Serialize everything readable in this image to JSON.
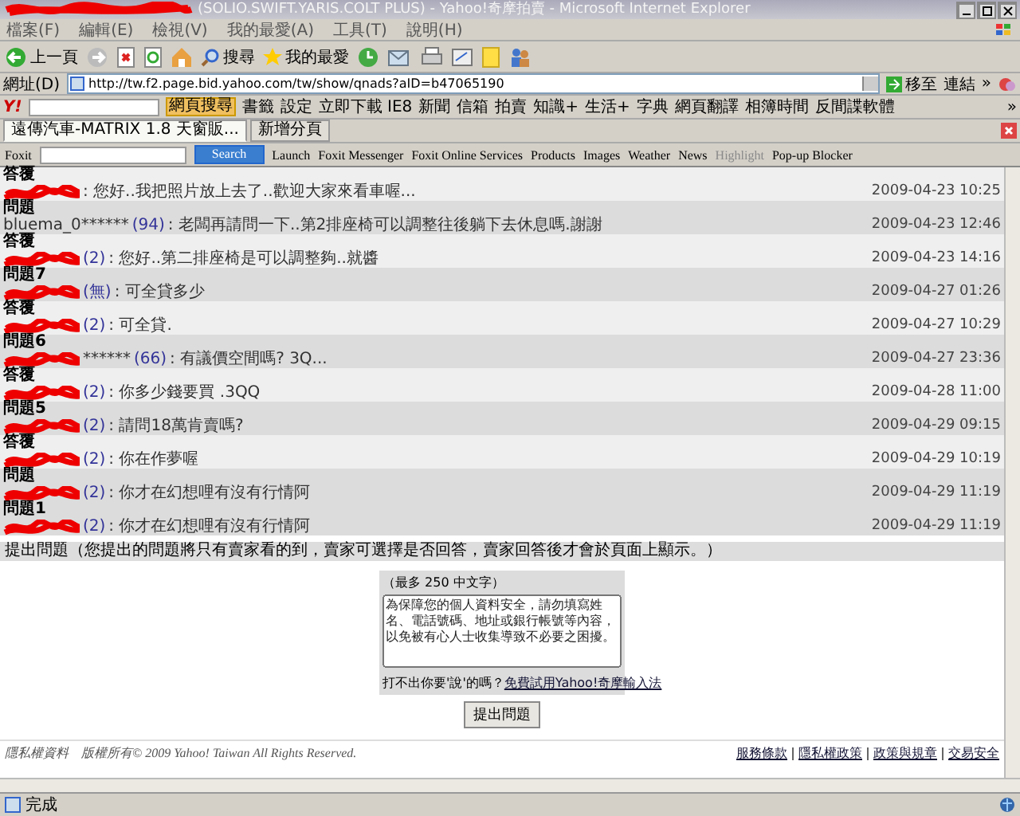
{
  "window": {
    "title": "(SOLIO.SWIFT.YARIS.COLT PLUS) - Yahoo!奇摩拍賣 - Microsoft Internet Explorer",
    "title_redacted": true
  },
  "menu": [
    "檔案(F)",
    "編輯(E)",
    "檢視(V)",
    "我的最愛(A)",
    "工具(T)",
    "說明(H)"
  ],
  "toolbar": {
    "back": "上一頁",
    "search": "搜尋",
    "favorites": "我的最愛"
  },
  "address": {
    "label": "網址(D)",
    "value": "http://tw.f2.page.bid.yahoo.com/tw/show/qnads?aID=b47065190",
    "go": "移至",
    "links": "連結",
    "more": "»"
  },
  "yahoo_toolbar": {
    "logo": "Y!",
    "search_button": "網頁搜尋",
    "items": [
      "書籤",
      "設定",
      "立即下載 IE8",
      "新聞",
      "信箱",
      "拍賣",
      "知識+",
      "生活+",
      "字典",
      "網頁翻譯",
      "相簿時間",
      "反間諜軟體"
    ],
    "more": "»"
  },
  "tabs": [
    {
      "label": "遠傳汽車-MATRIX 1.8 天窗販...",
      "selected": true
    },
    {
      "label": "新增分頁",
      "selected": false
    }
  ],
  "foxit": {
    "logo": "Foxit",
    "search_button": "Search",
    "items": [
      {
        "label": "Launch",
        "disabled": false
      },
      {
        "label": "Foxit Messenger",
        "disabled": false
      },
      {
        "label": "Foxit Online Services",
        "disabled": false
      },
      {
        "label": "Products",
        "disabled": false
      },
      {
        "label": "Images",
        "disabled": false
      },
      {
        "label": "Weather",
        "disabled": false
      },
      {
        "label": "News",
        "disabled": false
      },
      {
        "label": "Highlight",
        "disabled": true
      },
      {
        "label": "Pop-up Blocker",
        "disabled": false
      }
    ]
  },
  "entries": [
    {
      "kind": "answer",
      "heading": "答覆",
      "redacted": true,
      "text": ": 您好..我把照片放上去了..歡迎大家來看車喔...",
      "time": "2009-04-23 10:25"
    },
    {
      "kind": "question",
      "heading": "問題",
      "redacted": false,
      "author": "bluema_0******",
      "rating": "(94)",
      "text": ": 老闆再請問一下..第2排座椅可以調整往後躺下去休息嗎.謝謝",
      "time": "2009-04-23 12:46"
    },
    {
      "kind": "answer",
      "heading": "答覆",
      "redacted": true,
      "rating": "(2)",
      "text": ": 您好..第二排座椅是可以調整夠..就醬",
      "time": "2009-04-23 14:16"
    },
    {
      "kind": "question",
      "heading": "問題7",
      "redacted": true,
      "rating": "(無)",
      "text": ": 可全貸多少",
      "time": "2009-04-27 01:26"
    },
    {
      "kind": "answer",
      "heading": "答覆",
      "redacted": true,
      "rating": "(2)",
      "text": ": 可全貸.",
      "time": "2009-04-27 10:29"
    },
    {
      "kind": "question",
      "heading": "問題6",
      "redacted": true,
      "author": "******",
      "rating": "(66)",
      "text": ": 有議價空間嗎? 3Q...",
      "time": "2009-04-27 23:36"
    },
    {
      "kind": "answer",
      "heading": "答覆",
      "redacted": true,
      "rating": "(2)",
      "text": ": 你多少錢要買 .3QQ",
      "time": "2009-04-28 11:00"
    },
    {
      "kind": "question",
      "heading": "問題5",
      "redacted": true,
      "rating": "(2)",
      "text": ": 請問18萬肯賣嗎?",
      "time": "2009-04-29 09:15"
    },
    {
      "kind": "answer",
      "heading": "答覆",
      "redacted": true,
      "rating": "(2)",
      "text": ": 你在作夢喔",
      "time": "2009-04-29 10:19"
    },
    {
      "kind": "question",
      "heading": "問題",
      "redacted": true,
      "rating": "(2)",
      "text": ": 你才在幻想哩有沒有行情阿",
      "time": "2009-04-29 11:19"
    },
    {
      "kind": "question",
      "heading": "問題1",
      "redacted": true,
      "rating": "(2)",
      "text": ": 你才在幻想哩有沒有行情阿",
      "time": "2009-04-29 11:19"
    }
  ],
  "ask": {
    "title": "提出問題（您提出的問題將只有賣家看的到，賣家可選擇是否回答，賣家回答後才會於頁面上顯示。）",
    "limit": "（最多 250 中文字）",
    "placeholder": "為保障您的個人資料安全，請勿填寫姓名、電話號碼、地址或銀行帳號等內容，以免被有心人士收集導致不必要之困擾。",
    "hint": "打不出你要'說'的嗎？",
    "hint_link": "免費試用Yahoo!奇摩輸入法",
    "submit": "提出問題"
  },
  "footer": {
    "text": "隱私權資料　版權所有© 2009 Yahoo! Taiwan All Rights Reserved.",
    "links": [
      "服務條款",
      "隱私權政策",
      "政策與規章",
      "交易安全"
    ]
  },
  "status_bar": {
    "text": "完成"
  }
}
